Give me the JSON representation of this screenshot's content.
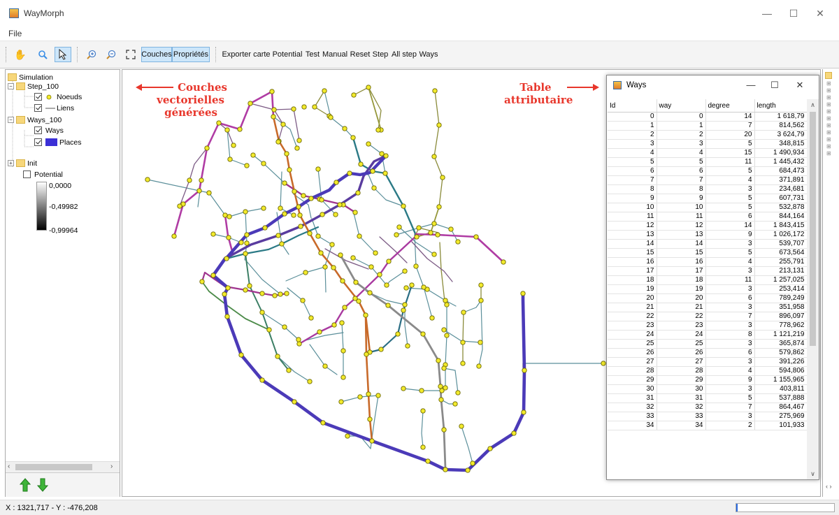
{
  "window": {
    "title": "WayMorph",
    "minimize": "—",
    "maximize": "☐",
    "close": "✕"
  },
  "menu": {
    "file": "File"
  },
  "toolbar": {
    "pan_icon": "✋",
    "zoom_icon": "🔍",
    "select_icon": "↖",
    "zoom_in_icon": "⊕",
    "zoom_out_icon": "⊖",
    "fit_icon": "⤢",
    "couches": "Couches",
    "proprietes": "Propriétés",
    "exporter_carte": "Exporter carte",
    "potential": "Potential",
    "test": "Test",
    "manual": "Manual",
    "reset": "Reset",
    "step": "Step",
    "all_step": "All step",
    "ways": "Ways"
  },
  "tree": {
    "simulation": "Simulation",
    "step": "Step_100",
    "noeuds": "Noeuds",
    "liens": "Liens",
    "ways_layer": "Ways_100",
    "ways": "Ways",
    "places": "Places",
    "init": "Init",
    "potential": "Potential",
    "legend_max": "0,0000",
    "legend_mid": "-0,49982",
    "legend_min": "-0,99964",
    "place_color": "#3b2fd6"
  },
  "annotations": {
    "layers_line1": "Couches",
    "layers_line2": "vectorielles",
    "layers_line3": "générées",
    "table_line1": "Table",
    "table_line2": "attributaire"
  },
  "ways_window": {
    "title": "Ways",
    "columns": [
      "Id",
      "way",
      "degree",
      "length"
    ],
    "rows": [
      [
        "0",
        "0",
        "14",
        "1 618,79"
      ],
      [
        "1",
        "1",
        "7",
        "814,562"
      ],
      [
        "2",
        "2",
        "20",
        "3 624,79"
      ],
      [
        "3",
        "3",
        "5",
        "348,815"
      ],
      [
        "4",
        "4",
        "15",
        "1 490,934"
      ],
      [
        "5",
        "5",
        "11",
        "1 445,432"
      ],
      [
        "6",
        "6",
        "5",
        "684,473"
      ],
      [
        "7",
        "7",
        "4",
        "371,891"
      ],
      [
        "8",
        "8",
        "3",
        "234,681"
      ],
      [
        "9",
        "9",
        "5",
        "607,731"
      ],
      [
        "10",
        "10",
        "5",
        "532,878"
      ],
      [
        "11",
        "11",
        "6",
        "844,164"
      ],
      [
        "12",
        "12",
        "14",
        "1 843,415"
      ],
      [
        "13",
        "13",
        "9",
        "1 026,172"
      ],
      [
        "14",
        "14",
        "3",
        "539,707"
      ],
      [
        "15",
        "15",
        "5",
        "673,564"
      ],
      [
        "16",
        "16",
        "4",
        "255,791"
      ],
      [
        "17",
        "17",
        "3",
        "213,131"
      ],
      [
        "18",
        "18",
        "11",
        "1 257,025"
      ],
      [
        "19",
        "19",
        "3",
        "253,414"
      ],
      [
        "20",
        "20",
        "6",
        "789,249"
      ],
      [
        "21",
        "21",
        "3",
        "351,958"
      ],
      [
        "22",
        "22",
        "7",
        "896,097"
      ],
      [
        "23",
        "23",
        "3",
        "778,962"
      ],
      [
        "24",
        "24",
        "8",
        "1 121,219"
      ],
      [
        "25",
        "25",
        "3",
        "365,874"
      ],
      [
        "26",
        "26",
        "6",
        "579,862"
      ],
      [
        "27",
        "27",
        "3",
        "391,226"
      ],
      [
        "28",
        "28",
        "4",
        "594,806"
      ],
      [
        "29",
        "29",
        "9",
        "1 155,965"
      ],
      [
        "30",
        "30",
        "3",
        "403,811"
      ],
      [
        "31",
        "31",
        "5",
        "537,888"
      ],
      [
        "32",
        "32",
        "7",
        "864,467"
      ],
      [
        "33",
        "33",
        "3",
        "275,969"
      ],
      [
        "34",
        "34",
        "2",
        "101,933"
      ]
    ]
  },
  "status": {
    "coords": "X : 1321,717 - Y : -476,208"
  }
}
